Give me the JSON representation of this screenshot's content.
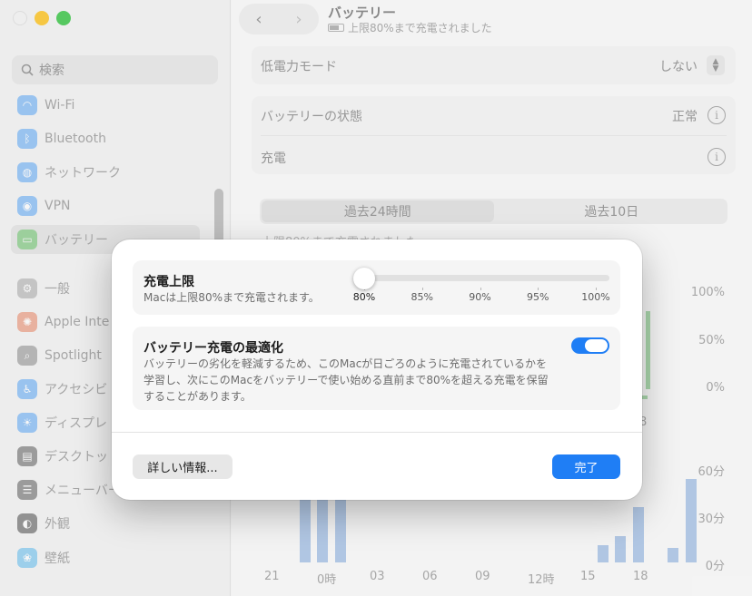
{
  "sidebar": {
    "search_placeholder": "検索",
    "items": [
      {
        "label": "Wi-Fi",
        "icon": "wifi-icon",
        "color": "#2d8cf0"
      },
      {
        "label": "Bluetooth",
        "icon": "bluetooth-icon",
        "color": "#2d8cf0"
      },
      {
        "label": "ネットワーク",
        "icon": "globe-icon",
        "color": "#2d8cf0"
      },
      {
        "label": "VPN",
        "icon": "vpn-icon",
        "color": "#2d8cf0"
      },
      {
        "label": "バッテリー",
        "icon": "battery-icon",
        "color": "#43b543"
      },
      {
        "label": "一般",
        "icon": "gear-icon",
        "color": "#8e8e8e"
      },
      {
        "label": "Apple Inte",
        "icon": "apple-intelligence-icon",
        "color": "#e0643a"
      },
      {
        "label": "Spotlight",
        "icon": "spotlight-icon",
        "color": "#6a6a6a"
      },
      {
        "label": "アクセシビ",
        "icon": "accessibility-icon",
        "color": "#2d8cf0"
      },
      {
        "label": "ディスプレ",
        "icon": "display-icon",
        "color": "#2d8cf0"
      },
      {
        "label": "デスクトッ",
        "icon": "desktop-icon",
        "color": "#333333"
      },
      {
        "label": "メニューバー",
        "icon": "menubar-icon",
        "color": "#333333"
      },
      {
        "label": "外観",
        "icon": "appearance-icon",
        "color": "#1d1d1d"
      },
      {
        "label": "壁紙",
        "icon": "wallpaper-icon",
        "color": "#35a7e8"
      }
    ]
  },
  "header": {
    "title": "バッテリー",
    "subtitle": "上限80%まで充電されました"
  },
  "settings": {
    "low_power_label": "低電力モード",
    "low_power_value": "しない",
    "health_label": "バッテリーの状態",
    "health_value": "正常",
    "charging_label": "充電"
  },
  "history_tabs": [
    "過去24時間",
    "過去10日"
  ],
  "history_caption": "上限80%まで充電されました",
  "chart": {
    "level_ticks": [
      "100%",
      "50%",
      "0%"
    ],
    "usage_ticks": [
      "60分",
      "30分",
      "0分"
    ],
    "x_labels": [
      "21",
      "0時",
      "03",
      "06",
      "09",
      "12時",
      "15",
      "18"
    ],
    "partial_x_label": "8",
    "usage_minutes": [
      57,
      57,
      57,
      0,
      0,
      0,
      0,
      0,
      0,
      0,
      0,
      0,
      0,
      0,
      0,
      0,
      0,
      11,
      17,
      35,
      0,
      9,
      53
    ]
  },
  "dialog": {
    "limit_title": "充電上限",
    "limit_desc": "Macは上限80%まで充電されます。",
    "slider_value": 80,
    "slider_ticks": [
      "80%",
      "85%",
      "90%",
      "95%",
      "100%"
    ],
    "optimize_title": "バッテリー充電の最適化",
    "optimize_desc_1": "バッテリーの劣化を軽減するため、このMacが日ごろのように充電されているかを",
    "optimize_desc_2": "学習し、次にこのMacをバッテリーで使い始める直前まで80%を超える充電を保留",
    "optimize_desc_3": "することがあります。",
    "optimize_enabled": true,
    "more_button": "詳しい情報...",
    "done_button": "完了"
  }
}
